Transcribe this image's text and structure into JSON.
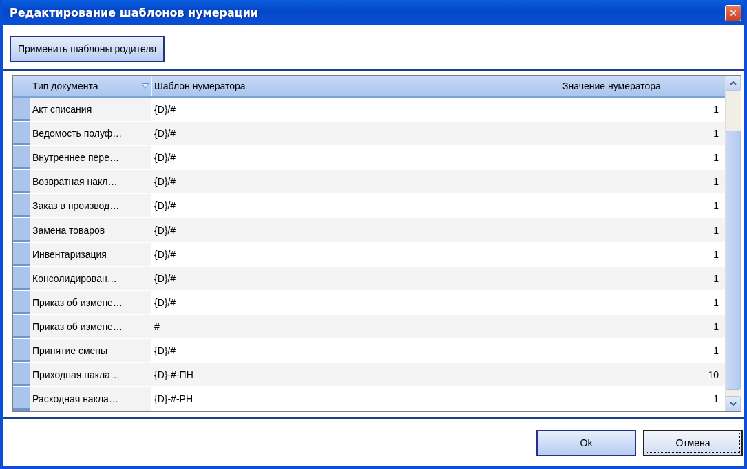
{
  "window": {
    "title": "Редактирование шаблонов нумерации",
    "close": "✕"
  },
  "toolbar": {
    "button": "Применить шаблоны родителя"
  },
  "table": {
    "columns": [
      {
        "label": "Тип документа",
        "sorted": true
      },
      {
        "label": "Шаблон нумератора",
        "sorted": false
      },
      {
        "label": "Значение нумератора",
        "sorted": false
      }
    ],
    "rows": [
      [
        "Акт списания",
        "{D}/#",
        "1"
      ],
      [
        "Ведомость полуф…",
        "{D}/#",
        "1"
      ],
      [
        "Внутреннее пере…",
        "{D}/#",
        "1"
      ],
      [
        "Возвратная накл…",
        "{D}/#",
        "1"
      ],
      [
        "Заказ в производ…",
        "{D}/#",
        "1"
      ],
      [
        "Замена товаров",
        "{D}/#",
        "1"
      ],
      [
        "Инвентаризация",
        "{D}/#",
        "1"
      ],
      [
        "Консолидирован…",
        "{D}/#",
        "1"
      ],
      [
        "Приказ об измене…",
        "{D}/#",
        "1"
      ],
      [
        "Приказ об измене…",
        "#",
        "1"
      ],
      [
        "Принятие смены",
        "{D}/#",
        "1"
      ],
      [
        "Приходная накла…",
        "{D}-#-ПН",
        "10"
      ],
      [
        "Расходная накла…",
        "{D}-#-РН",
        "1"
      ]
    ]
  },
  "buttons": [
    {
      "label": "Ok",
      "focused": false
    },
    {
      "label": "Отмена",
      "focused": true
    }
  ]
}
